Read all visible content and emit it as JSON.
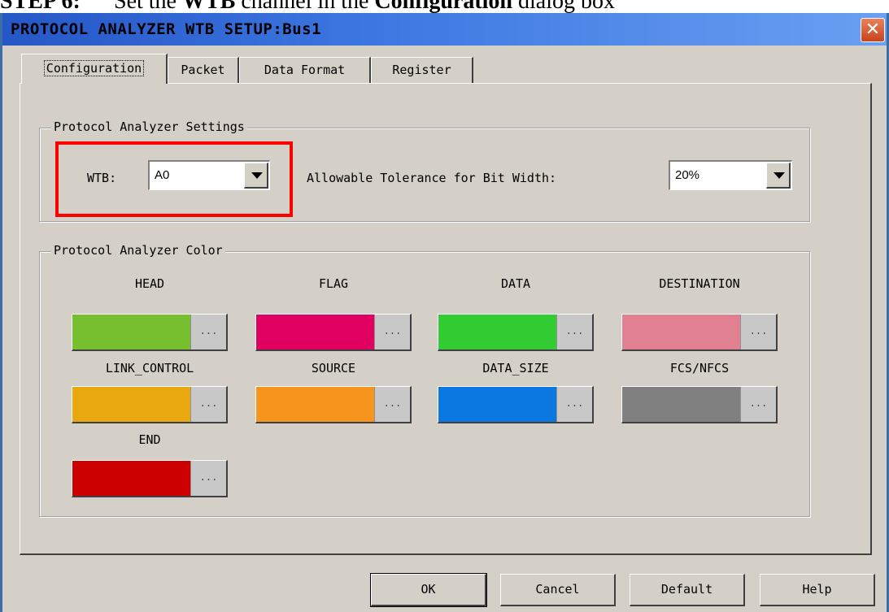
{
  "caption": {
    "step": "STEP 6:",
    "text_pre": "Set the ",
    "text_bold1": "WTB",
    "text_mid": " channel in the ",
    "text_bold2": "Configuration",
    "text_post": " dialog box"
  },
  "window": {
    "title": "PROTOCOL ANALYZER WTB SETUP:Bus1",
    "close_glyph": "✕"
  },
  "tabs": [
    {
      "label": "Configuration"
    },
    {
      "label": "Packet"
    },
    {
      "label": "Data Format"
    },
    {
      "label": "Register"
    }
  ],
  "settings": {
    "group_label": "Protocol Analyzer Settings",
    "wtb_label": "WTB:",
    "wtb_value": "A0",
    "tolerance_label": "Allowable Tolerance for Bit Width:",
    "tolerance_value": "20%"
  },
  "colors": {
    "group_label": "Protocol Analyzer Color",
    "ellipsis": "...",
    "items": [
      {
        "label": "HEAD",
        "color": "#77bf2f"
      },
      {
        "label": "FLAG",
        "color": "#e0005f"
      },
      {
        "label": "DATA",
        "color": "#33cc33"
      },
      {
        "label": "DESTINATION",
        "color": "#e08090"
      },
      {
        "label": "LINK_CONTROL",
        "color": "#eaa810"
      },
      {
        "label": "SOURCE",
        "color": "#f7941d"
      },
      {
        "label": "DATA_SIZE",
        "color": "#0a78e0"
      },
      {
        "label": "FCS/NFCS",
        "color": "#808080"
      },
      {
        "label": "END",
        "color": "#cc0000"
      }
    ]
  },
  "buttons": {
    "ok": "OK",
    "cancel": "Cancel",
    "default": "Default",
    "help": "Help"
  }
}
